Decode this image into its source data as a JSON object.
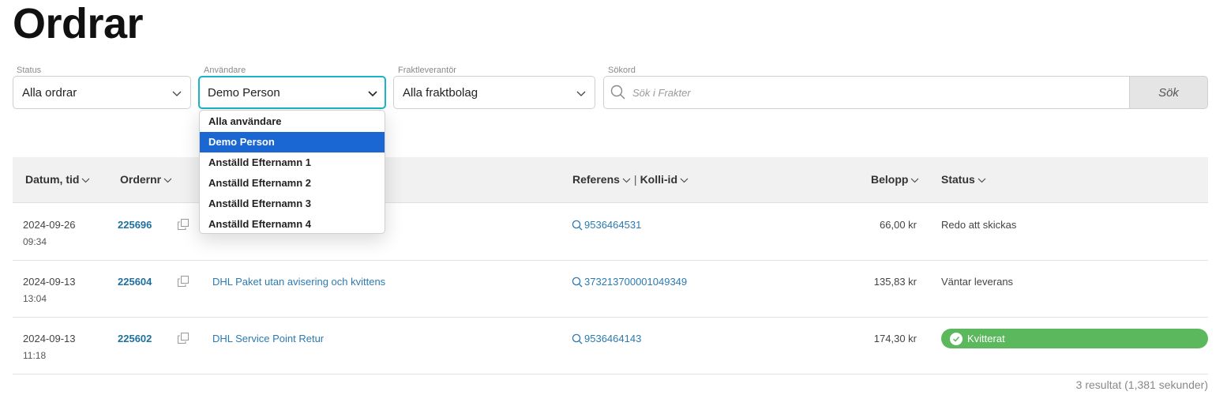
{
  "page": {
    "title": "Ordrar"
  },
  "filters": {
    "status": {
      "label": "Status",
      "value": "Alla ordrar"
    },
    "user": {
      "label": "Användare",
      "value": "Demo Person",
      "options": [
        "Alla användare",
        "Demo Person",
        "Anställd Efternamn 1",
        "Anställd Efternamn 2",
        "Anställd Efternamn 3",
        "Anställd Efternamn 4"
      ],
      "selected_index": 1
    },
    "carrier": {
      "label": "Fraktleverantör",
      "value": "Alla fraktbolag"
    },
    "search": {
      "label": "Sökord",
      "placeholder": "Sök i Frakter",
      "value": "",
      "button_label": "Sök"
    }
  },
  "table": {
    "headers": {
      "date": "Datum, tid",
      "order_no": "Ordernr",
      "reference": "Referens",
      "separator": "|",
      "parcel_id": "Kolli-id",
      "amount": "Belopp",
      "status": "Status"
    },
    "rows": [
      {
        "date": "2024-09-26",
        "time": "09:34",
        "order_no": "225696",
        "service": "",
        "reference": "9536464531",
        "amount": "66,00 kr",
        "status": "Redo att skickas",
        "status_badge": false
      },
      {
        "date": "2024-09-13",
        "time": "13:04",
        "order_no": "225604",
        "service": "DHL Paket utan avisering och kvittens",
        "reference": "373213700001049349",
        "amount": "135,83 kr",
        "status": "Väntar leverans",
        "status_badge": false
      },
      {
        "date": "2024-09-13",
        "time": "11:18",
        "order_no": "225602",
        "service": "DHL Service Point Retur",
        "reference": "9536464143",
        "amount": "174,30 kr",
        "status": "Kvitterat",
        "status_badge": true
      }
    ]
  },
  "footer": {
    "result_count": "3 resultat (1,381 sekunder)"
  },
  "colors": {
    "accent_focus": "#1bb3c8",
    "link": "#2b7ab1",
    "order_link": "#1f6f9e",
    "selected_option": "#1a66d2",
    "success_badge": "#5cb85c"
  },
  "icons": {
    "dropdown": "chevron-down-icon",
    "search": "search-icon",
    "copy": "copy-icon",
    "check": "check-circle-icon",
    "sort": "chevron-down-icon"
  }
}
